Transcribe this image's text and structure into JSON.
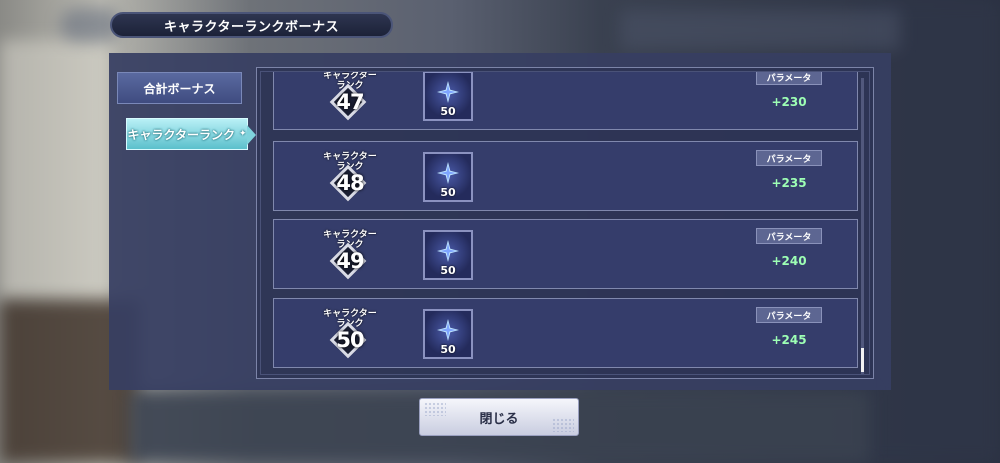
{
  "title": "キャラクターランクボーナス",
  "tabs": [
    {
      "label": "合計ボーナス",
      "active": false
    },
    {
      "label": "キャラクターランク",
      "active": true
    }
  ],
  "rank_caption_line1": "キャラクター",
  "rank_caption_line2": "ランク",
  "param_label": "パラメータ",
  "rows": [
    {
      "rank": "47",
      "item_icon": "star-crystal-icon",
      "item_qty": "50",
      "bonus": "+230"
    },
    {
      "rank": "48",
      "item_icon": "star-crystal-icon",
      "item_qty": "50",
      "bonus": "+235"
    },
    {
      "rank": "49",
      "item_icon": "star-crystal-icon",
      "item_qty": "50",
      "bonus": "+240"
    },
    {
      "rank": "50",
      "item_icon": "star-crystal-icon",
      "item_qty": "50",
      "bonus": "+245"
    }
  ],
  "close_label": "閉じる",
  "colors": {
    "panel": "#373e62",
    "row": "#353d6b",
    "active_tab": "#7fd3dc",
    "bonus_value": "#9dffb4"
  }
}
